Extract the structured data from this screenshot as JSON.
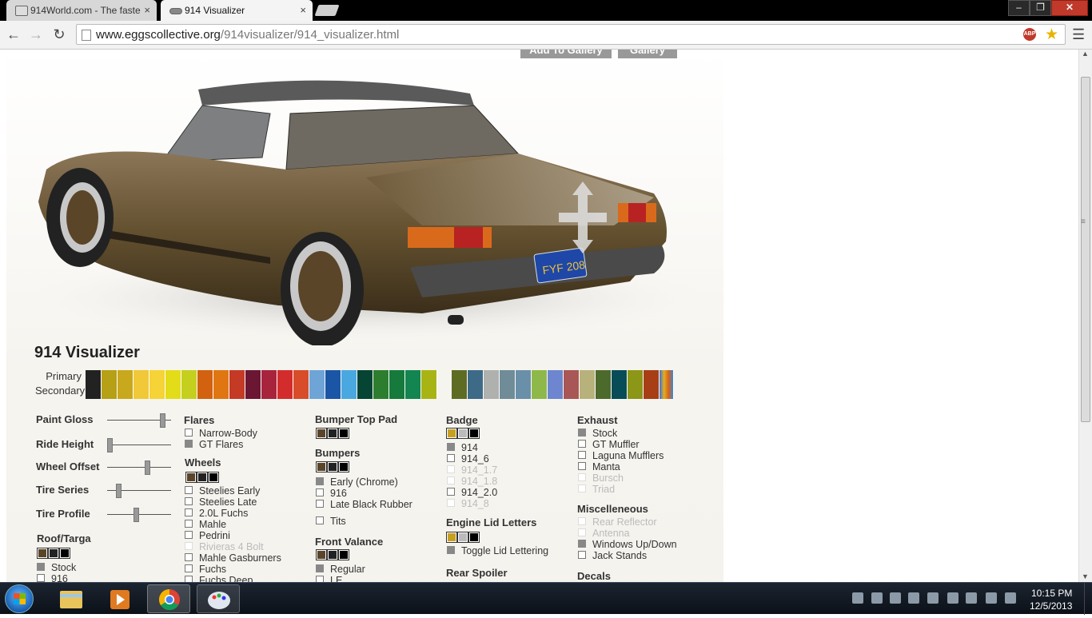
{
  "browser": {
    "tabs": [
      {
        "title": "914World.com - The faste",
        "close": "×"
      },
      {
        "title": "914 Visualizer",
        "close": "×"
      }
    ],
    "window_buttons": {
      "minimize": "–",
      "maximize": "❐",
      "close": "✕"
    },
    "url_host": "www.eggscollective.org",
    "url_path": "/914visualizer/914_visualizer.html",
    "abp": "ABP"
  },
  "page": {
    "buttons": {
      "add_to_gallery": "Add To Gallery",
      "gallery": "Gallery"
    },
    "license_plate": "FYF 208",
    "title": "914 Visualizer",
    "primary_label": "Primary",
    "secondary_label": "Secondary",
    "swatches_a": [
      "#222222",
      "#b5a016",
      "#c8a81c",
      "#f0c838",
      "#f6d336",
      "#e3dc18",
      "#c4d01d",
      "#d2620f",
      "#e07612",
      "#c53a25",
      "#6b1633",
      "#a8243c",
      "#d32c2c",
      "#d84c2a",
      "#6fa4d7",
      "#1b56a6",
      "#4aa8e0",
      "#064433",
      "#2d7d2f",
      "#157a3b",
      "#138550",
      "#a8b414"
    ],
    "swatches_b": [
      "#5e6b23",
      "#3d6a86",
      "#aeb1ae",
      "#6f8c98",
      "#6a8fa9",
      "#8fb84a",
      "#6d86cf",
      "#a95656",
      "#b7b27c",
      "#4b6a2c",
      "#084c58",
      "#8c9617",
      "#a83e16"
    ],
    "sliders": [
      {
        "label": "Paint Gloss",
        "value": 0.9
      },
      {
        "label": "Ride Height",
        "value": 0.0
      },
      {
        "label": "Wheel Offset",
        "value": 0.65
      },
      {
        "label": "Tire Series",
        "value": 0.15
      },
      {
        "label": "Tire Profile",
        "value": 0.45
      }
    ],
    "roof": {
      "heading": "Roof/Targa",
      "options": [
        "Stock",
        "916"
      ]
    },
    "flares": {
      "heading": "Flares",
      "options": [
        "Narrow-Body",
        "GT Flares"
      ]
    },
    "wheels": {
      "heading": "Wheels",
      "options": [
        "Steelies Early",
        "Steelies Late",
        "2.0L Fuchs",
        "Mahle",
        "Pedrini",
        "Rivieras 4 Bolt",
        "Mahle Gasburners",
        "Fuchs",
        "Fuchs Deep"
      ]
    },
    "bumper_pad": {
      "heading": "Bumper Top Pad"
    },
    "bumpers": {
      "heading": "Bumpers",
      "options": [
        "Early (Chrome)",
        "916",
        "Late Black Rubber",
        "Tits"
      ]
    },
    "front_valance": {
      "heading": "Front Valance",
      "options": [
        "Regular",
        "LE"
      ]
    },
    "badge": {
      "heading": "Badge",
      "options": [
        "914",
        "914_6",
        "914_1.7",
        "914_1.8",
        "914_2.0",
        "914_8"
      ]
    },
    "lid_letters": {
      "heading": "Engine Lid Letters",
      "options": [
        "Toggle Lid Lettering"
      ]
    },
    "rear_spoiler": {
      "heading": "Rear Spoiler"
    },
    "exhaust": {
      "heading": "Exhaust",
      "options": [
        "Stock",
        "GT Muffler",
        "Laguna Mufflers",
        "Manta",
        "Bursch",
        "Triad"
      ]
    },
    "misc": {
      "heading": "Miscelleneous",
      "options": [
        "Rear Reflector",
        "Antenna",
        "Windows Up/Down",
        "Jack Stands"
      ]
    },
    "decals": {
      "heading": "Decals"
    }
  },
  "taskbar": {
    "time": "10:15 PM",
    "date": "12/5/2013"
  }
}
